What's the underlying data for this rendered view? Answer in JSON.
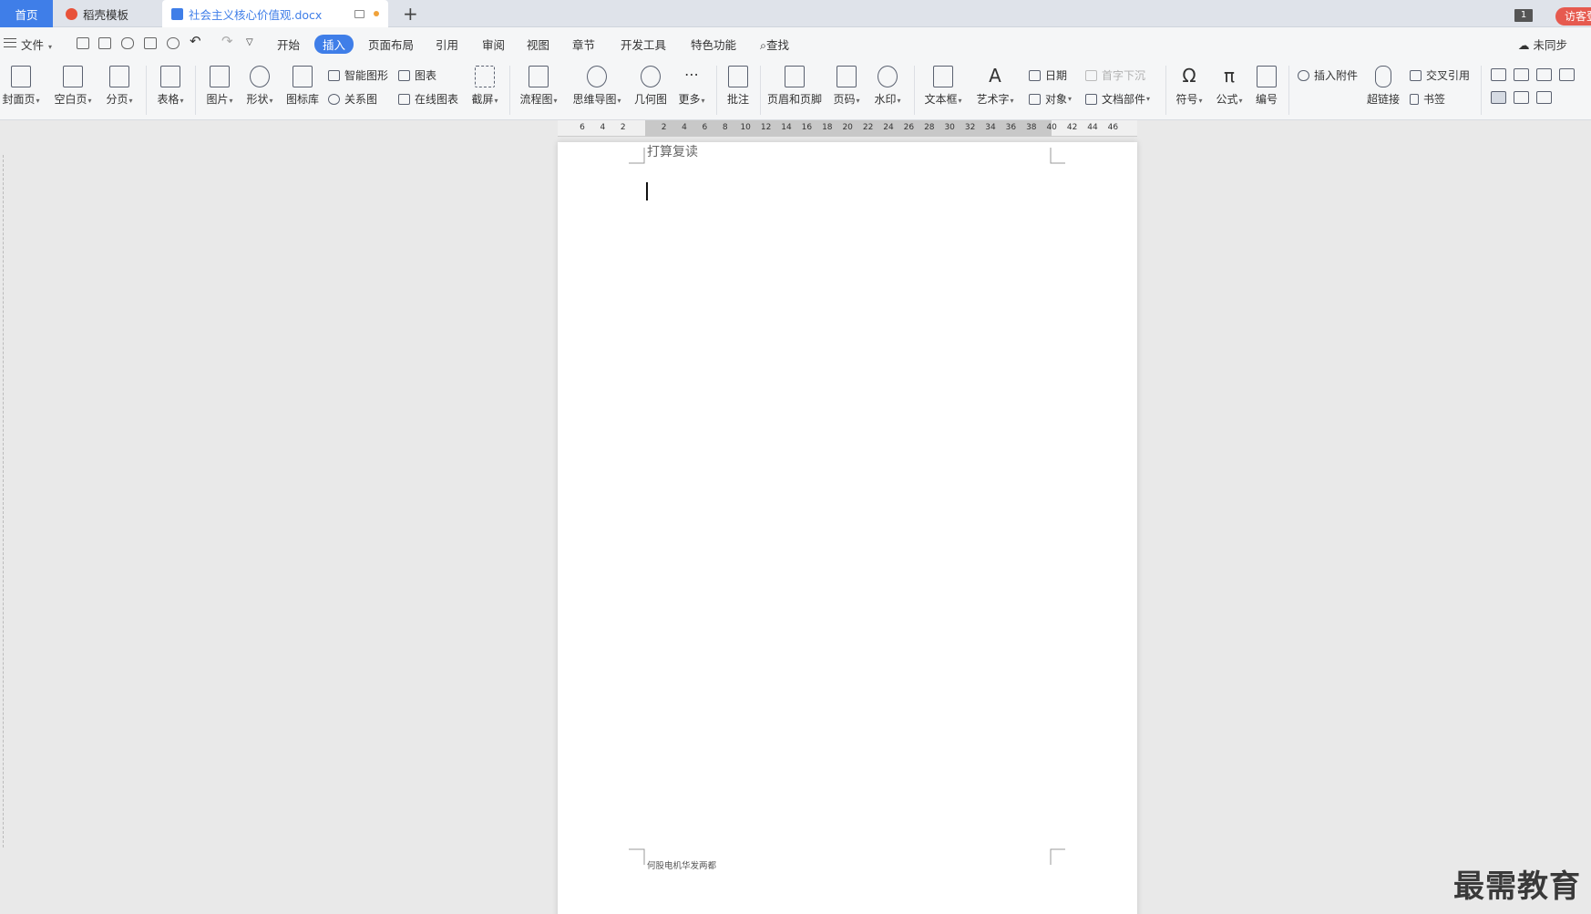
{
  "tabs": {
    "home": "首页",
    "template": "稻壳模板",
    "document": "社会主义核心价值观.docx",
    "window_count": "1",
    "visitor": "访客登"
  },
  "menu": {
    "file": "文件",
    "items": [
      "开始",
      "插入",
      "页面布局",
      "引用",
      "审阅",
      "视图",
      "章节",
      "开发工具",
      "特色功能"
    ],
    "active": "插入",
    "search": "查找",
    "sync": "未同步"
  },
  "ribbon": {
    "cover": "封面页",
    "blank": "空白页",
    "page_break": "分页",
    "table": "表格",
    "picture": "图片",
    "shape": "形状",
    "icon_lib": "图标库",
    "smart_art": "智能图形",
    "chart": "图表",
    "relation": "关系图",
    "online_chart": "在线图表",
    "screenshot": "截屏",
    "flowchart": "流程图",
    "mindmap": "思维导图",
    "geometry": "几何图",
    "more": "更多",
    "comment": "批注",
    "header_footer": "页眉和页脚",
    "page_num": "页码",
    "watermark": "水印",
    "textbox": "文本框",
    "wordart": "艺术字",
    "date": "日期",
    "drop_cap": "首字下沉",
    "object": "对象",
    "doc_parts": "文档部件",
    "symbol": "符号",
    "formula": "公式",
    "numbering": "编号",
    "attach": "插入附件",
    "hyperlink": "超链接",
    "cross_ref": "交叉引用",
    "bookmark": "书签"
  },
  "ruler": {
    "ticks": [
      "6",
      "4",
      "2",
      "",
      "2",
      "4",
      "6",
      "8",
      "10",
      "12",
      "14",
      "16",
      "18",
      "20",
      "22",
      "24",
      "26",
      "28",
      "30",
      "32",
      "34",
      "36",
      "38",
      "40",
      "42",
      "44",
      "46"
    ]
  },
  "document": {
    "header": "打算复读",
    "footer": "何股电机华发两都"
  },
  "watermark_text": "最需教育"
}
